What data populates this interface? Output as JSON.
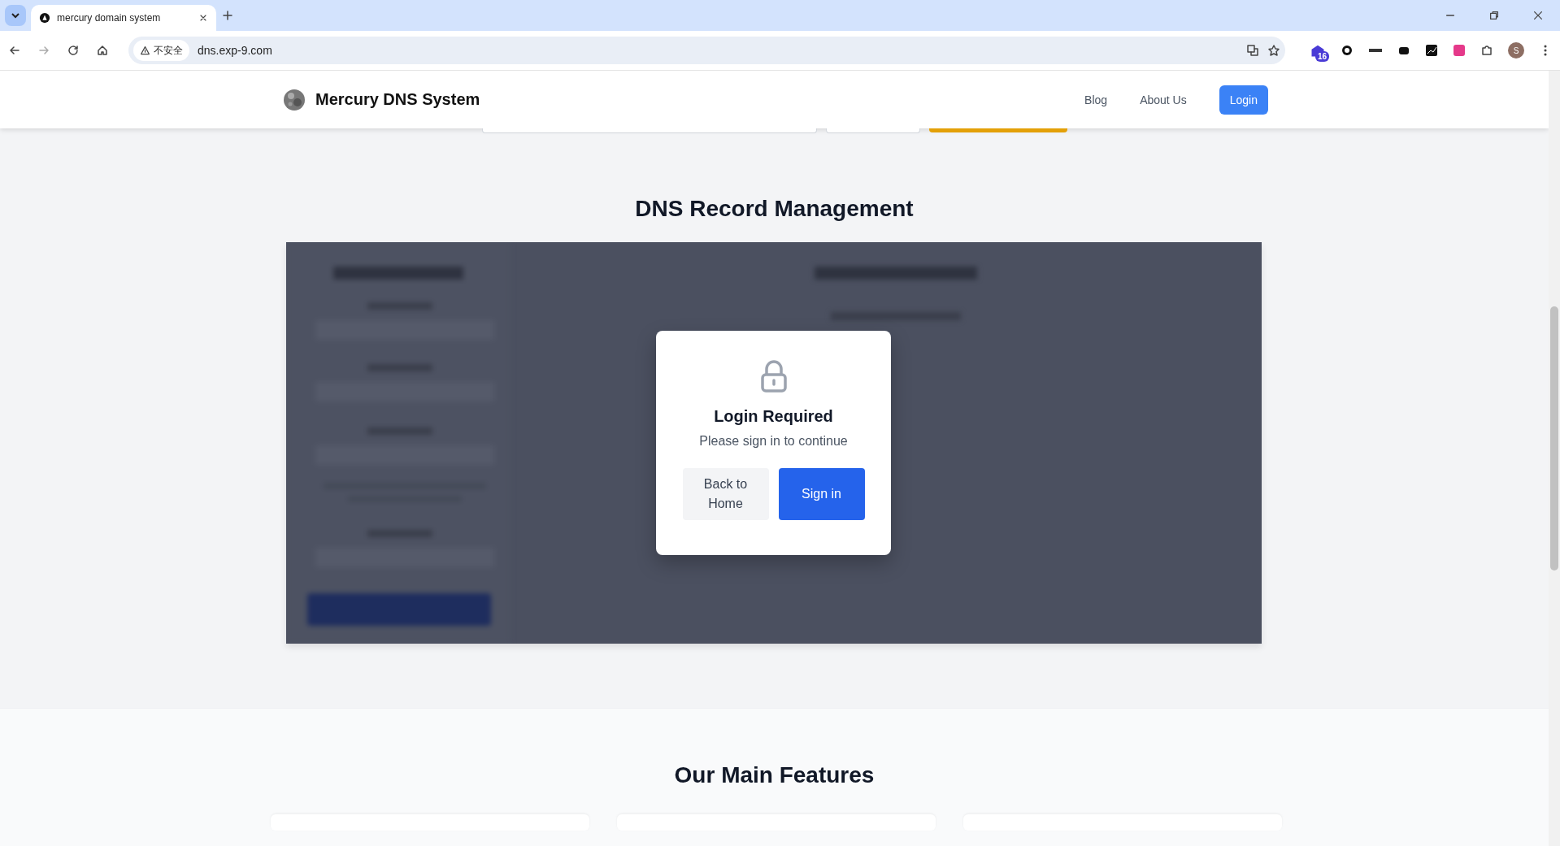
{
  "browser": {
    "tabs": [
      {
        "title": "mercury domain system",
        "selected": true
      }
    ],
    "security_label": "不安全",
    "url": "dns.exp-9.com",
    "extension_badge": "16",
    "profile_initial": "S"
  },
  "header": {
    "site_title": "Mercury DNS System",
    "nav": [
      {
        "label": "Blog",
        "kind": "link"
      },
      {
        "label": "About Us",
        "kind": "link"
      },
      {
        "label": "Login",
        "kind": "button"
      }
    ]
  },
  "records": {
    "heading": "DNS Record Management"
  },
  "modal": {
    "title": "Login Required",
    "message": "Please sign in to continue",
    "buttons": [
      {
        "label": "Back to Home",
        "kind": "secondary"
      },
      {
        "label": "Sign in",
        "kind": "primary"
      }
    ]
  },
  "features": {
    "heading": "Our Main Features"
  }
}
